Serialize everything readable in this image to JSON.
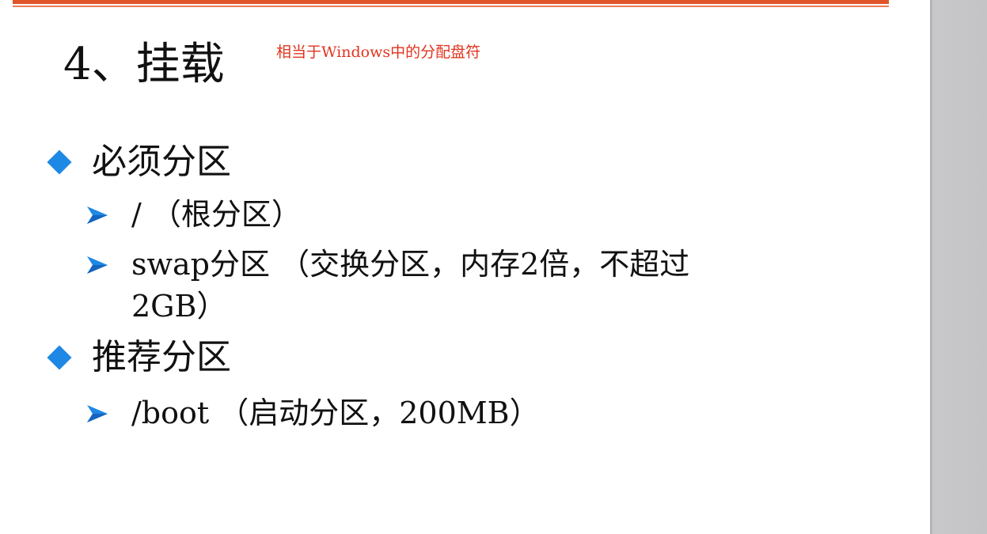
{
  "slide": {
    "title": "4、挂载",
    "note": "相当于Windows中的分配盘符",
    "sections": [
      {
        "heading": "必须分区",
        "items": [
          {
            "lines": [
              "/ （根分区）"
            ]
          },
          {
            "lines": [
              "swap分区 （交换分区，内存2倍，不超过",
              "2GB）"
            ]
          }
        ]
      },
      {
        "heading": "推荐分区",
        "items": [
          {
            "lines": [
              "/boot （启动分区，200MB）"
            ]
          }
        ]
      }
    ]
  },
  "icons": {
    "section_bullet": "diamond-bullet-icon",
    "item_bullet": "arrow-bullet-icon"
  },
  "colors": {
    "accent_bar": "#E0542A",
    "note_text": "#E0341E",
    "diamond": "#1E88E5",
    "arrow": "#1E88E5",
    "side_panel": "#C4C4C6"
  }
}
